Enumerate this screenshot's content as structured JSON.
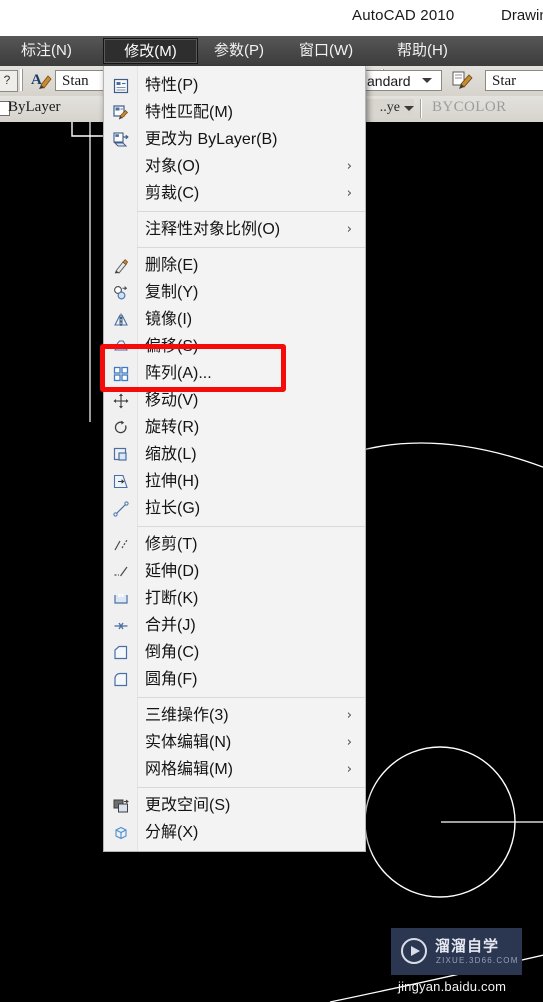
{
  "titlebar": {
    "app_title": "AutoCAD 2010",
    "document_title": "Drawin"
  },
  "menubar": {
    "items": [
      {
        "label": "标注(N)",
        "active": false
      },
      {
        "label": "修改(M)",
        "active": true
      },
      {
        "label": "参数(P)",
        "active": false
      },
      {
        "label": "窗口(W)",
        "active": false
      },
      {
        "label": "帮助(H)",
        "active": false
      }
    ]
  },
  "toolbar_row1": {
    "help_icon": "question-mark-icon",
    "text_style_icon": "text-style-icon",
    "text_style_value": "Stan",
    "dim_style_value": "andard",
    "match_prop_icon": "match-properties-icon",
    "table_style_value": "Star"
  },
  "toolbar_row2": {
    "color_swatch_label": "ByLayer",
    "layer_value": "..ye",
    "plot_style_value": "BYCOLOR"
  },
  "dropdown": {
    "title": "修改(M)",
    "groups": [
      {
        "items": [
          {
            "label": "特性(P)",
            "icon": "properties-icon",
            "submenu": false
          },
          {
            "label": "特性匹配(M)",
            "icon": "match-properties-icon",
            "submenu": false
          },
          {
            "label": "更改为 ByLayer(B)",
            "icon": "change-to-bylayer-icon",
            "submenu": false
          },
          {
            "label": "对象(O)",
            "icon": "none",
            "submenu": true
          },
          {
            "label": "剪裁(C)",
            "icon": "none",
            "submenu": true
          }
        ]
      },
      {
        "items": [
          {
            "label": "注释性对象比例(O)",
            "icon": "none",
            "submenu": true
          }
        ]
      },
      {
        "items": [
          {
            "label": "删除(E)",
            "icon": "erase-icon",
            "submenu": false
          },
          {
            "label": "复制(Y)",
            "icon": "copy-icon",
            "submenu": false
          },
          {
            "label": "镜像(I)",
            "icon": "mirror-icon",
            "submenu": false
          },
          {
            "label": "偏移(S)",
            "icon": "offset-icon",
            "submenu": false
          },
          {
            "label": "阵列(A)...",
            "icon": "array-icon",
            "submenu": false
          },
          {
            "label": "移动(V)",
            "icon": "move-icon",
            "submenu": false
          },
          {
            "label": "旋转(R)",
            "icon": "rotate-icon",
            "submenu": false
          },
          {
            "label": "缩放(L)",
            "icon": "scale-icon",
            "submenu": false
          },
          {
            "label": "拉伸(H)",
            "icon": "stretch-icon",
            "submenu": false
          },
          {
            "label": "拉长(G)",
            "icon": "lengthen-icon",
            "submenu": false
          }
        ]
      },
      {
        "items": [
          {
            "label": "修剪(T)",
            "icon": "trim-icon",
            "submenu": false
          },
          {
            "label": "延伸(D)",
            "icon": "extend-icon",
            "submenu": false
          },
          {
            "label": "打断(K)",
            "icon": "break-icon",
            "submenu": false
          },
          {
            "label": "合并(J)",
            "icon": "join-icon",
            "submenu": false
          },
          {
            "label": "倒角(C)",
            "icon": "chamfer-icon",
            "submenu": false
          },
          {
            "label": "圆角(F)",
            "icon": "fillet-icon",
            "submenu": false
          }
        ]
      },
      {
        "items": [
          {
            "label": "三维操作(3)",
            "icon": "none",
            "submenu": true
          },
          {
            "label": "实体编辑(N)",
            "icon": "none",
            "submenu": true
          },
          {
            "label": "网格编辑(M)",
            "icon": "none",
            "submenu": true
          }
        ]
      },
      {
        "items": [
          {
            "label": "更改空间(S)",
            "icon": "change-space-icon",
            "submenu": false
          },
          {
            "label": "分解(X)",
            "icon": "explode-icon",
            "submenu": false
          }
        ]
      }
    ],
    "submenu_arrow_glyph": "›"
  },
  "annotation": {
    "highlight_color": "#f60b0b",
    "highlighted_items": [
      "偏移(S)",
      "阵列(A)..."
    ]
  },
  "watermark": {
    "brand_cn": "溜溜自学",
    "brand_url": "ZIXUE.3D66.COM",
    "footer_url": "jingyan.baidu.com",
    "background_color": "#2b3650"
  },
  "canvas": {
    "background_color": "#000000",
    "stroke_color": "#ffffff"
  }
}
